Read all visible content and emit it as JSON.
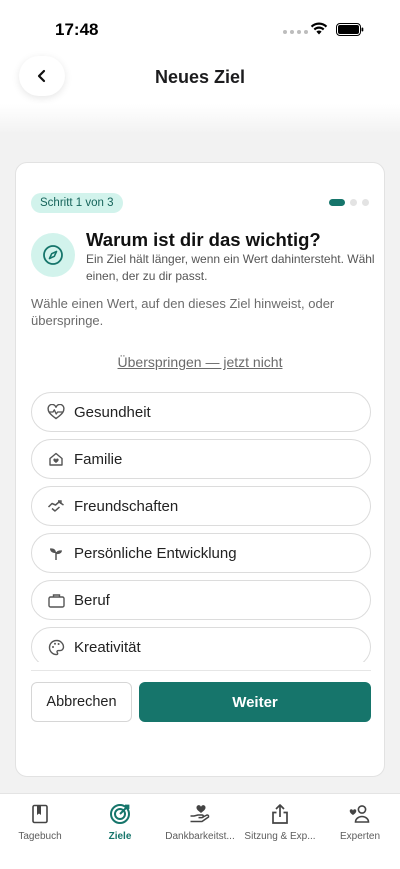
{
  "status_bar": {
    "time": "17:48"
  },
  "header": {
    "title": "Neues Ziel"
  },
  "card": {
    "step_badge": "Schritt 1 von 3",
    "progress": {
      "current_step": 1,
      "total_steps": 3
    },
    "title": "Warum ist dir das wichtig?",
    "subtitle": "Ein Ziel hält länger, wenn ein Wert dahintersteht. Wähl einen, der zu dir passt.",
    "instruction": "Wähle einen Wert, auf den dieses Ziel hinweist, oder überspringe.",
    "skip_link": "Überspringen — jetzt nicht",
    "values": [
      {
        "label": "Gesundheit",
        "icon": "heartbeat-icon"
      },
      {
        "label": "Familie",
        "icon": "home-icon"
      },
      {
        "label": "Freundschaften",
        "icon": "handshake-icon"
      },
      {
        "label": "Persönliche Entwicklung",
        "icon": "sprout-icon"
      },
      {
        "label": "Beruf",
        "icon": "briefcase-icon"
      },
      {
        "label": "Kreativität",
        "icon": "palette-icon"
      }
    ],
    "cancel_label": "Abbrechen",
    "next_label": "Weiter"
  },
  "tab_bar": {
    "tabs": [
      {
        "label": "Tagebuch",
        "icon": "journal-icon",
        "active": false
      },
      {
        "label": "Ziele",
        "icon": "target-icon",
        "active": true
      },
      {
        "label": "Dankbarkeitst...",
        "icon": "gratitude-icon",
        "active": false
      },
      {
        "label": "Sitzung & Exp...",
        "icon": "share-icon",
        "active": false
      },
      {
        "label": "Experten",
        "icon": "experts-icon",
        "active": false
      }
    ]
  },
  "colors": {
    "accent": "#16756b",
    "accent_light": "#d2f3ec"
  }
}
